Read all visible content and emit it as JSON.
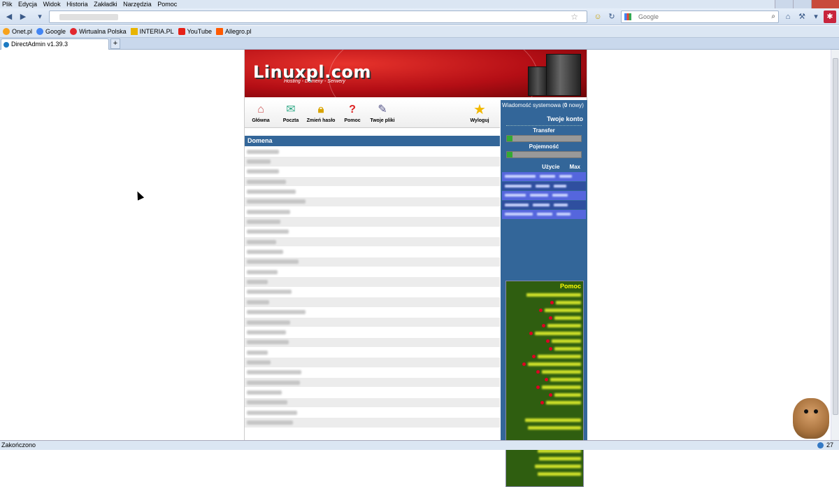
{
  "menu": [
    "Plik",
    "Edycja",
    "Widok",
    "Historia",
    "Zakładki",
    "Narzędzia",
    "Pomoc"
  ],
  "search": {
    "placeholder": "Google"
  },
  "bookmarks": [
    {
      "label": "Onet.pl",
      "color": "#f7a21b"
    },
    {
      "label": "Google",
      "color": "#4285f4"
    },
    {
      "label": "Wirtualna Polska",
      "color": "#e2262d"
    },
    {
      "label": "INTERIA.PL",
      "color": "#e8b400"
    },
    {
      "label": "YouTube",
      "color": "#e62117"
    },
    {
      "label": "Allegro.pl",
      "color": "#ff5a00"
    }
  ],
  "tab": {
    "title": "DirectAdmin v1.39.3"
  },
  "status": {
    "text": "Zakończono",
    "count": "27"
  },
  "banner": {
    "logo": "Linuxpl.com",
    "tagline": "Hosting - Domeny - Serwery"
  },
  "toolbar": {
    "home": "Główna",
    "mail": "Poczta",
    "password": "Zmień hasło",
    "help": "Pomoc",
    "files": "Twoje pliki",
    "logout": "Wyloguj"
  },
  "domains": {
    "header": "Domena",
    "row_count": 28
  },
  "side": {
    "messages_prefix": "Wiadomość systemowa (",
    "messages_count": "0",
    "messages_suffix": " nowy)",
    "account_title": "Twoje konto",
    "transfer_label": "Transfer",
    "capacity_label": "Pojemność",
    "usage_label": "Użycie",
    "max_label": "Max"
  },
  "help": {
    "title": "Pomoc"
  }
}
